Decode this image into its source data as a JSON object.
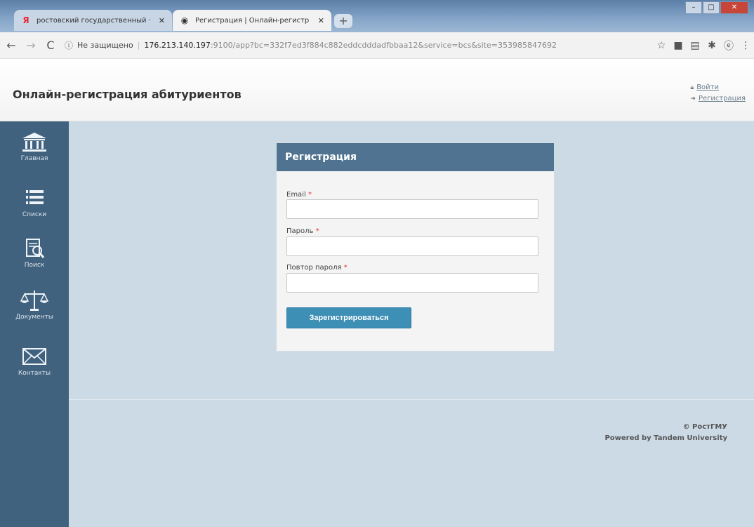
{
  "browser": {
    "tabs": [
      {
        "label": "ростовский государственный ·",
        "favicon": "Я",
        "active": false
      },
      {
        "label": "Регистрация | Онлайн-регистр",
        "favicon": "◉",
        "active": true
      }
    ],
    "new_tab": "+",
    "address": {
      "security": "Не защищено",
      "host": "176.213.140.197",
      "rest": ":9100/app?bc=332f7ed3f884c882eddcdddadfbbaa12&service=bcs&site=353985847692"
    },
    "nav": {
      "back": "←",
      "forward": "→",
      "reload": "C",
      "info": "ⓘ",
      "star": "☆",
      "menu": "⋮"
    },
    "window_controls": {
      "minimize": "–",
      "maximize": "□",
      "close": "✕"
    }
  },
  "header": {
    "title": "Онлайн-регистрация абитуриентов",
    "login_label": "Войти",
    "register_label": "Регистрация"
  },
  "sidebar": {
    "items": [
      {
        "label": "Главная",
        "icon": "institution-icon"
      },
      {
        "label": "Списки",
        "icon": "list-icon"
      },
      {
        "label": "Поиск",
        "icon": "search-document-icon"
      },
      {
        "label": "Документы",
        "icon": "scales-icon"
      },
      {
        "label": "Контакты",
        "icon": "envelope-icon"
      }
    ]
  },
  "form": {
    "title": "Регистрация",
    "email_label": "Email",
    "password_label": "Пароль",
    "password_repeat_label": "Повтор пароля",
    "required_mark": "*",
    "email_value": "",
    "password_value": "",
    "password_repeat_value": "",
    "submit_label": "Зарегистрироваться"
  },
  "footer": {
    "copyright": "© РостГМУ",
    "powered": "Powered by Tandem University"
  },
  "colors": {
    "sidebar": "#41627f",
    "panel_header": "#4f7390",
    "button": "#3e8fb6",
    "background": "#ccdae6"
  }
}
